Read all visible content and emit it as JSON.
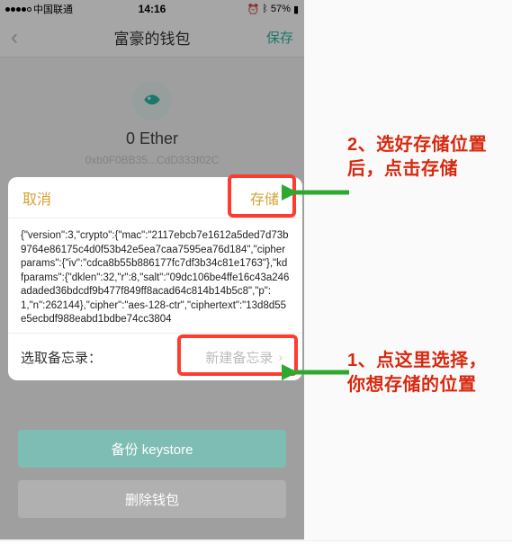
{
  "statusbar": {
    "carrier": "中国联通",
    "time": "14:16",
    "battery": "57%"
  },
  "nav": {
    "title": "富豪的钱包",
    "save": "保存"
  },
  "wallet": {
    "balance": "0 Ether",
    "address": "0xb0F0BB35...CdD333f02C"
  },
  "sheet": {
    "cancel": "取消",
    "store": "存储",
    "json_text": "{\"version\":3,\"crypto\":{\"mac\":\"2117ebcb7e1612a5ded7d73b9764e86175c4d0f53b42e5ea7caa7595ea76d184\",\"cipherparams\":{\"iv\":\"cdca8b55b886177fc7df3b34c81e1763\"},\"kdfparams\":{\"dklen\":32,\"r\":8,\"salt\":\"09dc106be4ffe16c43a246adaded36bdcdf9b477f849ff8acad64c814b14b5c8\",\"p\":1,\"n\":262144},\"cipher\":\"aes-128-ctr\",\"ciphertext\":\"13d8d55e5ecbdf988eabd1bdbe74cc3804",
    "memo_label": "选取备忘录：",
    "memo_button": "新建备忘录"
  },
  "buttons": {
    "backup": "备份 keystore",
    "delete": "删除钱包"
  },
  "annotations": {
    "note2": "2、选好存储位置后，点击存储",
    "note1": "1、点这里选择，你想存储的位置"
  }
}
